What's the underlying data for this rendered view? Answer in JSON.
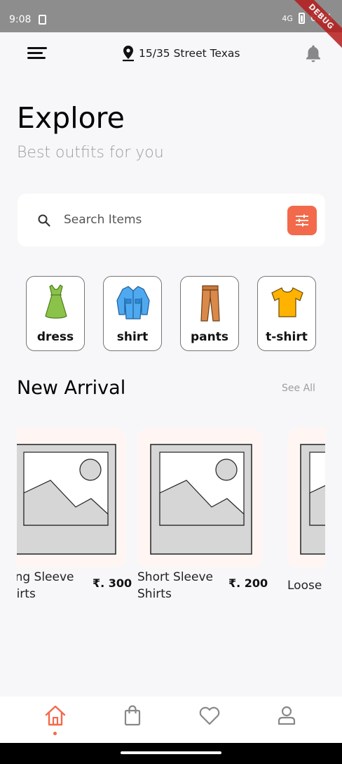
{
  "status_bar": {
    "time": "9:08",
    "network": "4G",
    "battery": "68%",
    "debug_label": "DEBUG"
  },
  "header": {
    "location": "15/35 Street Texas"
  },
  "hero": {
    "title": "Explore",
    "subtitle": "Best outfits for you"
  },
  "search": {
    "placeholder": "Search Items"
  },
  "categories": [
    {
      "label": "dress",
      "icon": "dress-icon"
    },
    {
      "label": "shirt",
      "icon": "shirt-icon"
    },
    {
      "label": "pants",
      "icon": "pants-icon"
    },
    {
      "label": "t-shirt",
      "icon": "tshirt-icon"
    }
  ],
  "new_arrival": {
    "title": "New Arrival",
    "see_all": "See All",
    "products": [
      {
        "name": "Long Sleeve Shirts",
        "price": "₹. 300"
      },
      {
        "name": "Short Sleeve Shirts",
        "price": "₹. 200"
      },
      {
        "name": "Loose Shirts",
        "price": ""
      }
    ]
  },
  "bottom_nav": [
    "home-icon",
    "bag-icon",
    "heart-icon",
    "profile-icon"
  ],
  "colors": {
    "accent": "#f26a4b",
    "background": "#f7f7fa"
  }
}
